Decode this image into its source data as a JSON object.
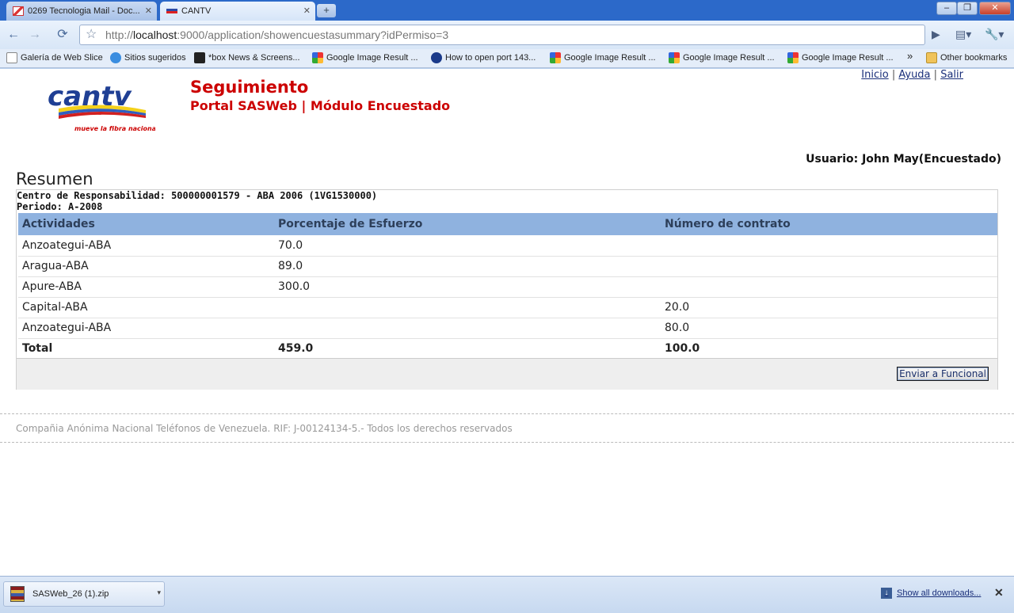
{
  "browser": {
    "tabs": [
      {
        "title": "0269 Tecnologia Mail - Doc...",
        "favicon": "gmail-icon",
        "active": false
      },
      {
        "title": "CANTV",
        "favicon": "cantv-favicon",
        "active": true
      }
    ],
    "newtab_label": "+",
    "window_controls": {
      "minimize": "‒",
      "maximize": "❐",
      "close": "✕"
    },
    "nav": {
      "back": "←",
      "forward": "→",
      "reload": "⟳"
    },
    "url": {
      "scheme": "http://",
      "host": "localhost",
      "rest": ":9000/application/showencuestasummary?idPermiso=3"
    },
    "bookmarks": [
      {
        "label": "Galería de Web Slice",
        "icon": "page-icon"
      },
      {
        "label": "Sitios sugeridos",
        "icon": "ie-icon"
      },
      {
        "label": "*box News & Screens...",
        "icon": "box-icon"
      },
      {
        "label": "Google Image Result ...",
        "icon": "google-icon"
      },
      {
        "label": "How to open port 143...",
        "icon": "plus-circle-icon"
      },
      {
        "label": "Google Image Result ...",
        "icon": "google-icon"
      },
      {
        "label": "Google Image Result ...",
        "icon": "google-icon"
      },
      {
        "label": "Google Image Result ...",
        "icon": "google-icon"
      }
    ],
    "bookmarks_overflow": "»",
    "other_bookmarks": "Other bookmarks"
  },
  "header": {
    "logo_text": "cantv",
    "logo_tagline": "mueve la fibra nacional",
    "title": "Seguimiento",
    "subtitle": "Portal SASWeb | Módulo Encuestado",
    "links": [
      "Inicio",
      "Ayuda",
      "Salir"
    ],
    "separator": "|",
    "user": "Usuario: John May(Encuestado)"
  },
  "summary": {
    "heading": "Resumen",
    "centro": "Centro de Responsabilidad: 500000001579 - ABA 2006 (1VG1530000)",
    "periodo": "Periodo: A-2008",
    "columns": [
      "Actividades",
      "Porcentaje de Esfuerzo",
      "Número de contrato"
    ],
    "rows": [
      {
        "actividad": "Anzoategui-ABA",
        "porcentaje": "70.0",
        "contrato": ""
      },
      {
        "actividad": "Aragua-ABA",
        "porcentaje": "89.0",
        "contrato": ""
      },
      {
        "actividad": "Apure-ABA",
        "porcentaje": "300.0",
        "contrato": ""
      },
      {
        "actividad": "Capital-ABA",
        "porcentaje": "",
        "contrato": "20.0"
      },
      {
        "actividad": "Anzoategui-ABA",
        "porcentaje": "",
        "contrato": "80.0"
      }
    ],
    "total": {
      "label": "Total",
      "porcentaje": "459.0",
      "contrato": "100.0"
    },
    "button": "Enviar a Funcional"
  },
  "footer": {
    "text": "Compañia Anónima Nacional Teléfonos de Venezuela. RIF: J-00124134-5.- Todos los derechos reservados"
  },
  "downloads": {
    "item": "SASWeb_26 (1).zip",
    "show_all": "Show all downloads...",
    "close": "✕"
  },
  "colors": {
    "brand_red": "#cc0000",
    "table_header": "#8fb2df",
    "logo_blue": "#1f3f94"
  }
}
